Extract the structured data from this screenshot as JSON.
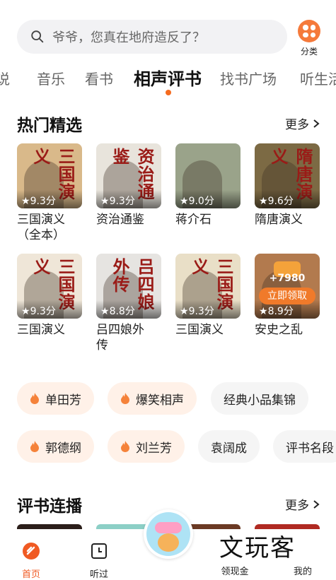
{
  "search": {
    "placeholder": "爷爷，您真在地府造反了？"
  },
  "category": {
    "label": "分类"
  },
  "tabs": [
    "说",
    "音乐",
    "看书",
    "相声评书",
    "找书广场",
    "听生活"
  ],
  "active_tab": "相声评书",
  "hot_section": {
    "title": "热门精选",
    "more": "更多"
  },
  "cards": [
    {
      "title": "三国演义\n（全本）",
      "rating": "9.3分",
      "cover_text": "三国演义",
      "cover_color": "#d9b98a"
    },
    {
      "title": "资治通鉴",
      "rating": "9.3分",
      "cover_text": "资治通鉴",
      "cover_color": "#e8e4dc"
    },
    {
      "title": "蒋介石",
      "rating": "9.0分",
      "cover_text": "",
      "cover_color": "#9aa38a"
    },
    {
      "title": "隋唐演义",
      "rating": "9.6分",
      "cover_text": "隋唐演义",
      "cover_color": "#7c6a44"
    },
    {
      "title": "三国演义",
      "rating": "9.3分",
      "cover_text": "三国演义",
      "cover_color": "#efe6d8"
    },
    {
      "title": "吕四娘外\n传",
      "rating": "8.8分",
      "cover_text": "吕四娘外传",
      "cover_color": "#e6e4e1"
    },
    {
      "title": "三国演义",
      "rating": "9.3分",
      "cover_text": "三国演义",
      "cover_color": "#e9dfc7"
    },
    {
      "title": "安史之乱",
      "rating": "8.9分",
      "cover_text": "",
      "cover_color": "#b27a4e"
    }
  ],
  "bonus": {
    "amount": "+7980",
    "button": "立即领取"
  },
  "tags_row1": [
    {
      "label": "单田芳",
      "hot": true
    },
    {
      "label": "爆笑相声",
      "hot": true
    },
    {
      "label": "经典小品集锦",
      "hot": false
    }
  ],
  "tags_row2": [
    {
      "label": "郭德纲",
      "hot": true
    },
    {
      "label": "刘兰芳",
      "hot": true
    },
    {
      "label": "袁阔成",
      "hot": false
    },
    {
      "label": "评书名段",
      "hot": false
    }
  ],
  "serial_section": {
    "title": "评书连播",
    "more": "更多"
  },
  "nav": {
    "home": "首页",
    "listened": "听过",
    "earn": "领现金",
    "mine": "我的"
  },
  "watermark": "文玩客",
  "colors": {
    "accent": "#f05a23",
    "tag_hot_bg": "#fff1e8"
  }
}
